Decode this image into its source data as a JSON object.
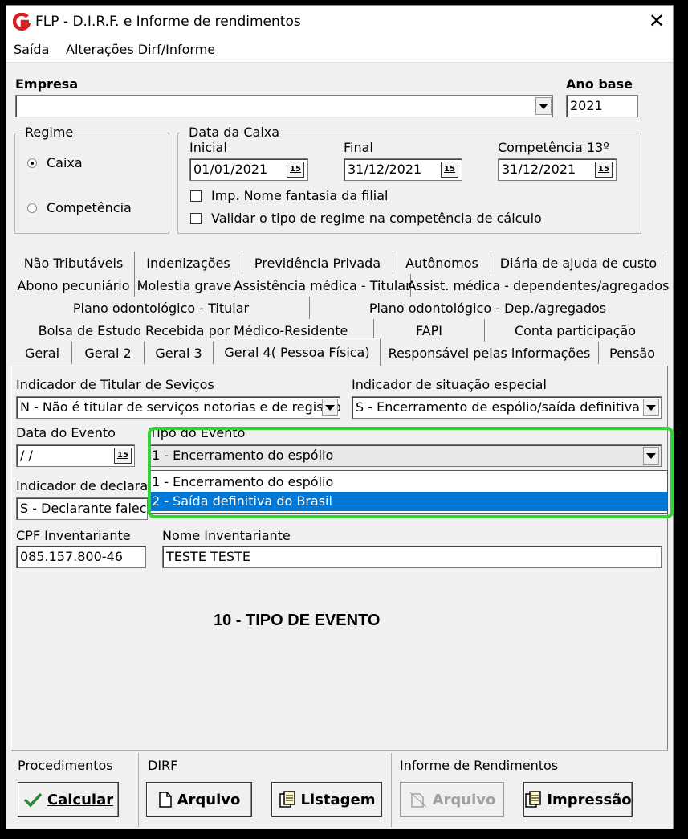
{
  "window": {
    "title": "FLP - D.I.R.F. e Informe de rendimentos",
    "close": "✕"
  },
  "menu": {
    "saida": "Saída",
    "alteracoes": "Alterações Dirf/Informe"
  },
  "empresa": {
    "label": "Empresa",
    "value": ""
  },
  "ano_base": {
    "label": "Ano base",
    "value": "2021"
  },
  "regime": {
    "title": "Regime",
    "caixa": "Caixa",
    "competencia": "Competência",
    "selected": "caixa"
  },
  "data_caixa": {
    "title": "Data da Caixa",
    "inicial_label": "Inicial",
    "inicial": "01/01/2021",
    "final_label": "Final",
    "final": "31/12/2021",
    "comp13_label": "Competência 13º",
    "comp13": "31/12/2021",
    "cal_icon_text": "15",
    "chk_fantasia": "Imp. Nome fantasia da filial",
    "chk_validar": "Validar o tipo de regime na competência de cálculo"
  },
  "tabs": {
    "row1": [
      "Não Tributáveis",
      "Indenizações",
      "Previdência Privada",
      "Autônomos",
      "Diária de ajuda de custo"
    ],
    "row2": [
      "Abono pecuniário",
      "Molestia grave",
      "Assistência médica - Titular",
      "Assist. médica - dependentes/agregados"
    ],
    "row3": [
      "Plano odontológico - Titular",
      "Plano odontológico - Dep./agregados"
    ],
    "row4": [
      "Bolsa de Estudo Recebida por Médico-Residente",
      "FAPI",
      "Conta participação"
    ],
    "row5": [
      "Geral",
      "Geral 2",
      "Geral 3",
      "Geral 4( Pessoa Física)",
      "Responsável pelas informações",
      "Pensão"
    ]
  },
  "geral4": {
    "ind_titular_label": "Indicador de Titular de Seviços",
    "ind_titular_value": "N - Não é titular de serviços notorias e de registros",
    "ind_situacao_label": "Indicador de situação especial",
    "ind_situacao_value": "S - Encerramento de espólio/saída definitiva do",
    "data_evento_label": "Data do Evento",
    "data_evento_value": " /  /",
    "tipo_evento_label": "Tipo do Evento",
    "tipo_evento_value": "1 - Encerramento do espólio",
    "tipo_evento_options": [
      "1 - Encerramento do espólio",
      "2 - Saída definitiva do Brasil"
    ],
    "ind_declarante_label": "Indicador de declarant",
    "ind_declarante_value": "S - Declarante falecid",
    "cpf_label": "CPF Inventariante",
    "cpf_value": "085.157.800-46",
    "nome_label": "Nome Inventariante",
    "nome_value": "TESTE TESTE",
    "caption": "10 - TIPO DE EVENTO"
  },
  "footer": {
    "procedimentos": "Procedimentos",
    "dirf": "DIRF",
    "informe": "Informe de Rendimentos",
    "calcular": "Calcular",
    "arquivo": "Arquivo",
    "listagem": "Listagem",
    "arquivo2": "Arquivo",
    "impressao": "Impressão"
  }
}
